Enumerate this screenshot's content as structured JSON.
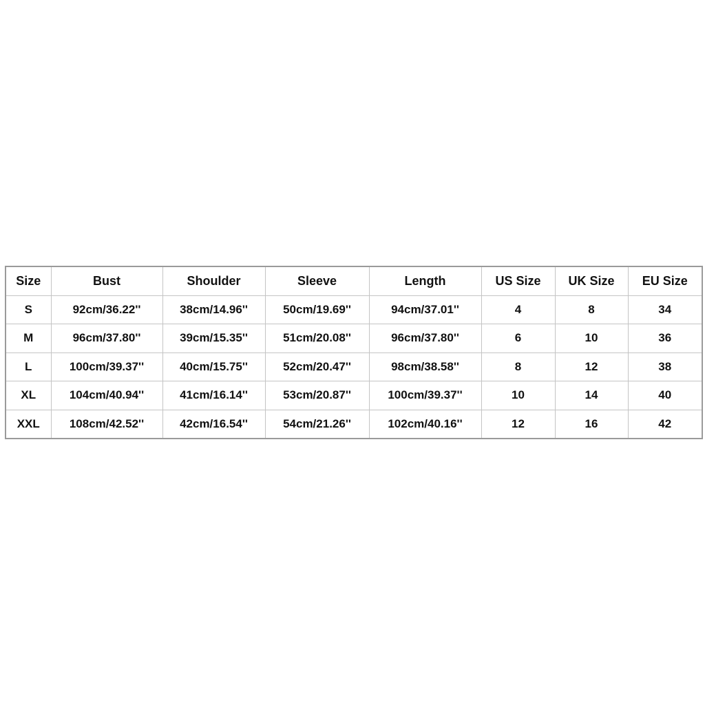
{
  "table": {
    "headers": [
      "Size",
      "Bust",
      "Shoulder",
      "Sleeve",
      "Length",
      "US Size",
      "UK Size",
      "EU Size"
    ],
    "rows": [
      [
        "S",
        "92cm/36.22''",
        "38cm/14.96''",
        "50cm/19.69''",
        "94cm/37.01''",
        "4",
        "8",
        "34"
      ],
      [
        "M",
        "96cm/37.80''",
        "39cm/15.35''",
        "51cm/20.08''",
        "96cm/37.80''",
        "6",
        "10",
        "36"
      ],
      [
        "L",
        "100cm/39.37''",
        "40cm/15.75''",
        "52cm/20.47''",
        "98cm/38.58''",
        "8",
        "12",
        "38"
      ],
      [
        "XL",
        "104cm/40.94''",
        "41cm/16.14''",
        "53cm/20.87''",
        "100cm/39.37''",
        "10",
        "14",
        "40"
      ],
      [
        "XXL",
        "108cm/42.52''",
        "42cm/16.54''",
        "54cm/21.26''",
        "102cm/40.16''",
        "12",
        "16",
        "42"
      ]
    ]
  }
}
